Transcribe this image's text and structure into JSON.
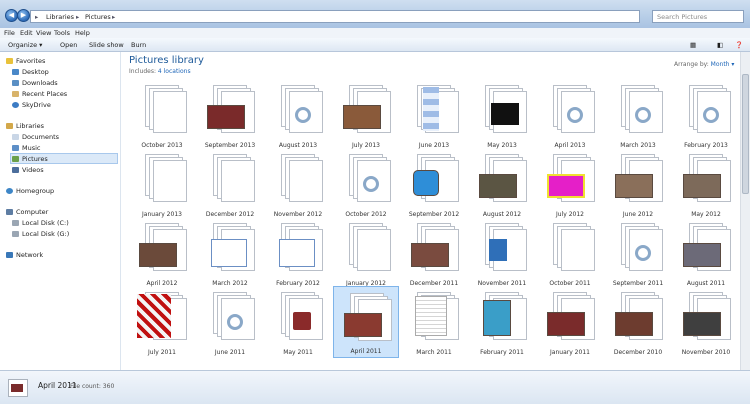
{
  "address": {
    "root": "Libraries",
    "current": "Pictures"
  },
  "search": {
    "placeholder": "Search Pictures"
  },
  "menu": [
    "File",
    "Edit",
    "View",
    "Tools",
    "Help"
  ],
  "toolbar": {
    "organize": "Organize ▾",
    "open": "Open",
    "slideshow": "Slide show",
    "burn": "Burn"
  },
  "sidebar": {
    "favorites": "Favorites",
    "desktop": "Desktop",
    "downloads": "Downloads",
    "recent": "Recent Places",
    "skydrive": "SkyDrive",
    "libraries": "Libraries",
    "documents": "Documents",
    "music": "Music",
    "pictures": "Pictures",
    "videos": "Videos",
    "homegroup": "Homegroup",
    "computer": "Computer",
    "diskc": "Local Disk (C:)",
    "diskg": "Local Disk (G:)",
    "network": "Network"
  },
  "library": {
    "title": "Pictures library",
    "includes_prefix": "Includes: ",
    "includes_link": "4 locations",
    "arrange_prefix": "Arrange by: ",
    "arrange_value": "Month ▾"
  },
  "tiles": [
    {
      "label": "October 2013",
      "kind": "doc"
    },
    {
      "label": "September 2013",
      "kind": "photo",
      "color": "#7a2a2a"
    },
    {
      "label": "August 2013",
      "kind": "gear"
    },
    {
      "label": "July 2013",
      "kind": "photo",
      "color": "#8a5a3a"
    },
    {
      "label": "June 2013",
      "kind": "blue"
    },
    {
      "label": "May 2013",
      "kind": "advisory"
    },
    {
      "label": "April 2013",
      "kind": "gear"
    },
    {
      "label": "March 2013",
      "kind": "gear"
    },
    {
      "label": "February 2013",
      "kind": "gear"
    },
    {
      "label": "January 2013",
      "kind": "doc"
    },
    {
      "label": "December 2012",
      "kind": "doc"
    },
    {
      "label": "November 2012",
      "kind": "doc"
    },
    {
      "label": "October 2012",
      "kind": "gear"
    },
    {
      "label": "September 2012",
      "kind": "skype"
    },
    {
      "label": "August 2012",
      "kind": "photo",
      "color": "#5b5543"
    },
    {
      "label": "July 2012",
      "kind": "magenta"
    },
    {
      "label": "June 2012",
      "kind": "photo",
      "color": "#8a6f5a"
    },
    {
      "label": "May 2012",
      "kind": "photo",
      "color": "#7d6a5a"
    },
    {
      "label": "April 2012",
      "kind": "photo",
      "color": "#6b4a3a"
    },
    {
      "label": "March 2012",
      "kind": "word"
    },
    {
      "label": "February 2012",
      "kind": "word"
    },
    {
      "label": "January 2012",
      "kind": "doc"
    },
    {
      "label": "December 2011",
      "kind": "photo",
      "color": "#7a4b3f"
    },
    {
      "label": "November 2011",
      "kind": "m4a"
    },
    {
      "label": "October 2011",
      "kind": "doc"
    },
    {
      "label": "September 2011",
      "kind": "gear"
    },
    {
      "label": "August 2011",
      "kind": "photo",
      "color": "#6c6a78"
    },
    {
      "label": "July 2011",
      "kind": "red"
    },
    {
      "label": "June 2011",
      "kind": "gear"
    },
    {
      "label": "May 2011",
      "kind": "gearred"
    },
    {
      "label": "April 2011",
      "kind": "photo",
      "color": "#8a3a30",
      "selected": true
    },
    {
      "label": "March 2011",
      "kind": "docs"
    },
    {
      "label": "February 2011",
      "kind": "teal"
    },
    {
      "label": "January 2011",
      "kind": "photo",
      "color": "#7a2b2b"
    },
    {
      "label": "December 2010",
      "kind": "photo",
      "color": "#6d3c2f"
    },
    {
      "label": "November 2010",
      "kind": "photo",
      "color": "#3f3f3f"
    }
  ],
  "status": {
    "name": "April 2011",
    "info": "File count: 360"
  }
}
